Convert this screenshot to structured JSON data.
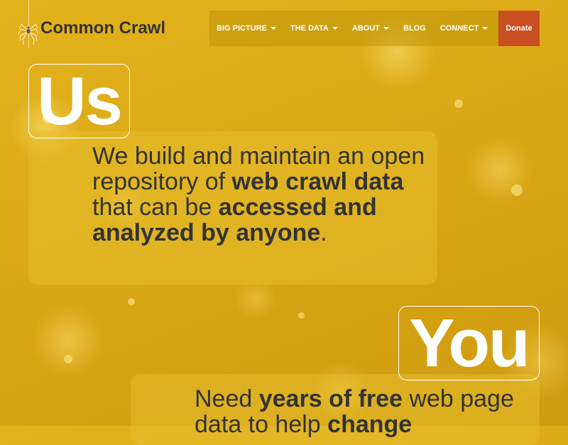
{
  "brand": {
    "name": "Common Crawl"
  },
  "nav": {
    "items": [
      {
        "label": "BIG PICTURE",
        "has_dropdown": true
      },
      {
        "label": "THE DATA",
        "has_dropdown": true
      },
      {
        "label": "ABOUT",
        "has_dropdown": true
      },
      {
        "label": "BLOG",
        "has_dropdown": false
      },
      {
        "label": "CONNECT",
        "has_dropdown": true
      }
    ],
    "donate": "Donate"
  },
  "sections": {
    "us": {
      "badge": "Us",
      "t1": "We build and maintain an open repository of ",
      "b1": "web crawl data",
      "t2": " that can be ",
      "b2": "accessed and analyzed by anyone",
      "t3": "."
    },
    "you": {
      "badge": "You",
      "t1": "Need ",
      "b1": "years of free",
      "t2": " web page data to help ",
      "b2": "change"
    }
  },
  "colors": {
    "background": "#dcaa17",
    "donate": "#c94f22",
    "text": "#333333",
    "badge_text": "#ffffff"
  },
  "icons": {
    "logo": "spider-icon",
    "dropdown": "caret-down-icon"
  }
}
